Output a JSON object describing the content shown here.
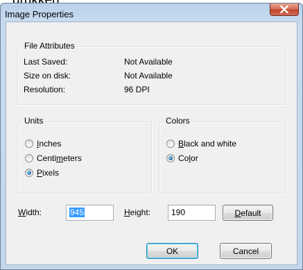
{
  "background_text": "drukken",
  "window": {
    "title": "Image Properties",
    "close_icon": "close-icon"
  },
  "file_attributes": {
    "legend": "File Attributes",
    "rows": [
      {
        "label": "Last Saved:",
        "value": "Not Available"
      },
      {
        "label": "Size on disk:",
        "value": "Not Available"
      },
      {
        "label": "Resolution:",
        "value": "96 DPI"
      }
    ]
  },
  "units": {
    "legend": "Units",
    "options": [
      {
        "pre": "",
        "key": "I",
        "post": "nches",
        "selected": false
      },
      {
        "pre": "Centi",
        "key": "m",
        "post": "eters",
        "selected": false
      },
      {
        "pre": "",
        "key": "P",
        "post": "ixels",
        "selected": true
      }
    ]
  },
  "colors": {
    "legend": "Colors",
    "options": [
      {
        "pre": "",
        "key": "B",
        "post": "lack and white",
        "selected": false
      },
      {
        "pre": "Co",
        "key": "l",
        "post": "or",
        "selected": true
      }
    ]
  },
  "size": {
    "width_pre": "",
    "width_key": "W",
    "width_post": "idth:",
    "width_value": "945",
    "height_pre": "",
    "height_key": "H",
    "height_post": "eight:",
    "height_value": "190"
  },
  "buttons": {
    "default_pre": "",
    "default_key": "D",
    "default_post": "efault",
    "ok": "OK",
    "cancel": "Cancel"
  }
}
